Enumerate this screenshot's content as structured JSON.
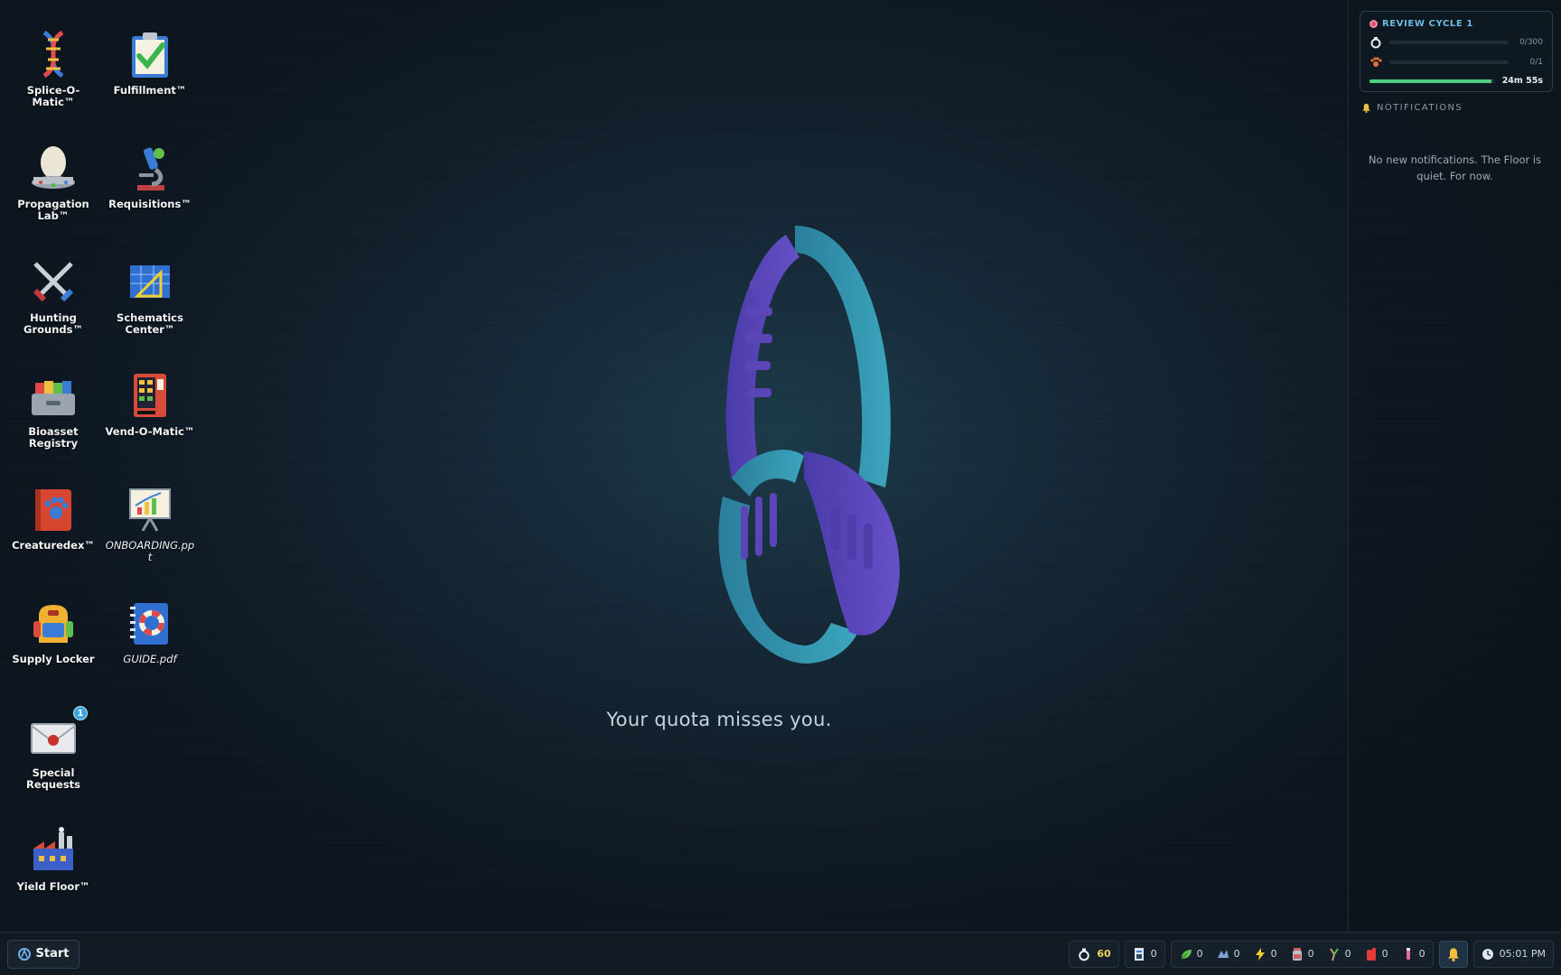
{
  "desktop": {
    "icons": [
      {
        "label": "Splice-O-Matic™",
        "icon": "dna-icon"
      },
      {
        "label": "Fulfillment™",
        "icon": "clipboard-check-icon"
      },
      {
        "label": "Propagation Lab™",
        "icon": "egg-incubator-icon"
      },
      {
        "label": "Requisitions™",
        "icon": "microscope-icon"
      },
      {
        "label": "Hunting Grounds™",
        "icon": "crossed-swords-icon"
      },
      {
        "label": "Schematics Center™",
        "icon": "blueprint-icon"
      },
      {
        "label": "Bioasset Registry",
        "icon": "file-drawer-icon"
      },
      {
        "label": "Vend-O-Matic™",
        "icon": "vending-machine-icon"
      },
      {
        "label": "Creaturedex™",
        "icon": "paw-book-icon"
      },
      {
        "label": "ONBOARDING.ppt",
        "icon": "presentation-icon"
      },
      {
        "label": "Supply Locker",
        "icon": "backpack-icon"
      },
      {
        "label": "GUIDE.pdf",
        "icon": "lifebuoy-book-icon"
      },
      {
        "label": "Special Requests",
        "icon": "envelope-icon",
        "badge": "1"
      },
      {
        "label": "Yield Floor™",
        "icon": "factory-icon"
      }
    ]
  },
  "center": {
    "tagline": "Your quota misses you."
  },
  "review": {
    "title": "REVIEW CYCLE 1",
    "rows": [
      {
        "icon": "ring-icon",
        "value": "0/300",
        "progress": 0
      },
      {
        "icon": "paw-icon",
        "value": "0/1",
        "progress": 0
      }
    ],
    "timer": {
      "value": "24m 55s",
      "progress": 0.97
    }
  },
  "notifications": {
    "title": "NOTIFICATIONS",
    "empty": "No new notifications. The Floor is quiet. For now."
  },
  "taskbar": {
    "start_label": "Start",
    "currency": "60",
    "file_count": "0",
    "resources": [
      {
        "icon": "leaf-icon",
        "value": "0",
        "color": "#5fbf4a"
      },
      {
        "icon": "crystal-icon",
        "value": "0",
        "color": "#7fa6d6"
      },
      {
        "icon": "lightning-icon",
        "value": "0",
        "color": "#f0d030"
      },
      {
        "icon": "jar-icon",
        "value": "0",
        "color": "#d06060"
      },
      {
        "icon": "wrench-icon",
        "value": "0",
        "color": "#c2a070"
      },
      {
        "icon": "fuel-can-icon",
        "value": "0",
        "color": "#e03a3a"
      },
      {
        "icon": "vial-icon",
        "value": "0",
        "color": "#e06a9a"
      }
    ],
    "clock": "05:01 PM"
  }
}
